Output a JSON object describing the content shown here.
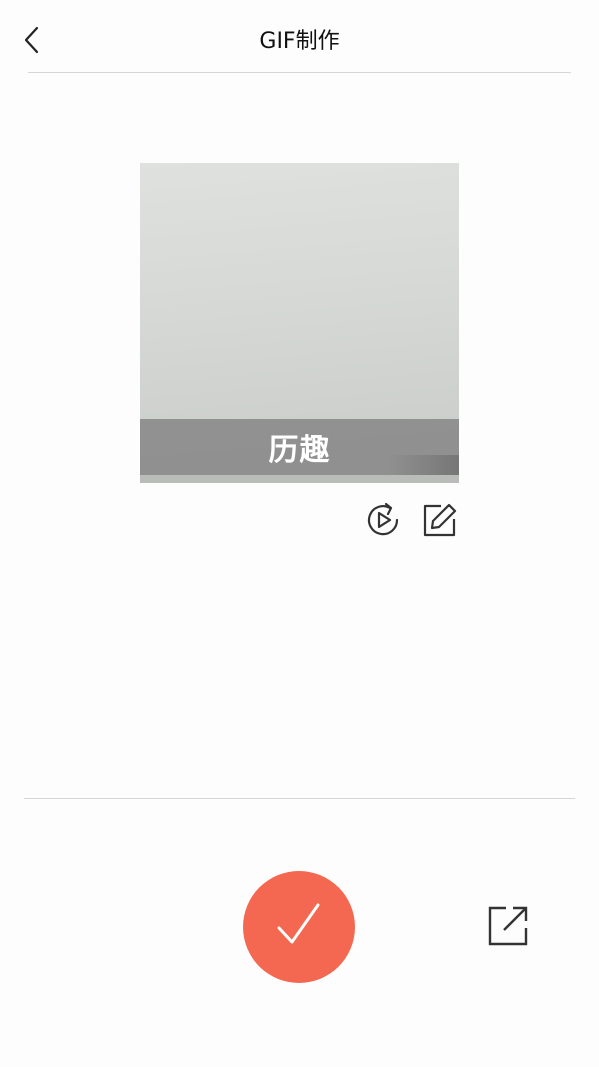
{
  "header": {
    "title": "GIF制作",
    "back_icon": "chevron-left-icon"
  },
  "preview": {
    "caption": "历趣"
  },
  "actions": {
    "replay_icon": "play-replay-icon",
    "edit_icon": "edit-icon"
  },
  "footer": {
    "confirm_icon": "checkmark-icon",
    "share_icon": "share-external-icon"
  },
  "colors": {
    "accent": "#f46751",
    "icon": "#333333",
    "divider": "#d6d6d6",
    "caption_bar": "#787878"
  }
}
